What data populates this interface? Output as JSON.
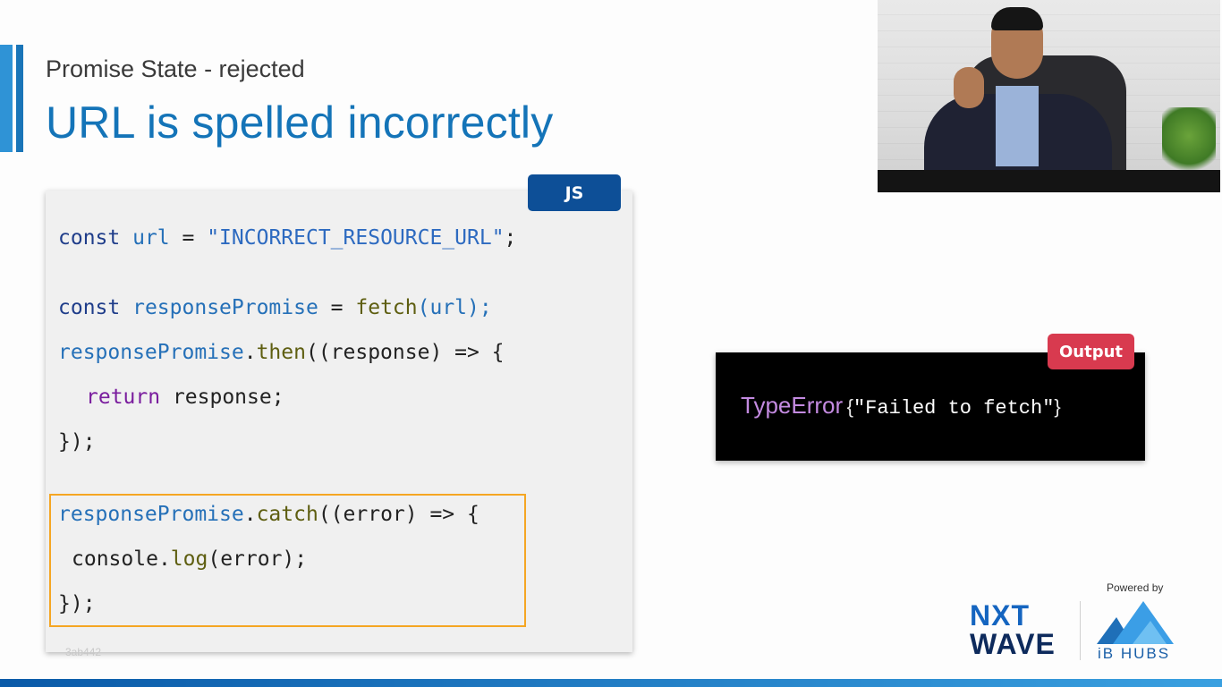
{
  "slide": {
    "subtitle": "Promise State - rejected",
    "title": "URL is spelled incorrectly",
    "watermark": "3ab442"
  },
  "code": {
    "badge": "JS",
    "line1": {
      "kw": "const",
      "var": "url",
      "eq": " = ",
      "str": "\"INCORRECT_RESOURCE_URL\"",
      "end": ";"
    },
    "line2": {
      "kw": "const",
      "var": "responsePromise",
      "eq": " = ",
      "fn": "fetch",
      "args": "(url);"
    },
    "line3": {
      "obj": "responsePromise",
      "dot": ".",
      "method": "then",
      "rest": "((response) => {"
    },
    "line4": {
      "kw": "return",
      "rest": " response;"
    },
    "line5": {
      "text": "});"
    },
    "line6": {
      "obj": "responsePromise",
      "dot": ".",
      "method": "catch",
      "rest": "((error) => {"
    },
    "line7": {
      "obj": "console",
      "dot": ".",
      "method": "log",
      "rest": "(error);"
    },
    "line8": {
      "text": "});"
    }
  },
  "output": {
    "badge": "Output",
    "type": "TypeError",
    "brace_open": "{",
    "message": "\"Failed to fetch\"",
    "brace_close": "}"
  },
  "branding": {
    "powered_by": "Powered by",
    "nxt": "NXT",
    "wave": "WAVE",
    "ib_hubs": "iB HUBS",
    "colors": {
      "title": "#1474b8",
      "accent": "#2f93d6",
      "output_badge": "#d83a4f",
      "js_badge": "#0d4f97",
      "highlight": "#f5a623"
    }
  }
}
